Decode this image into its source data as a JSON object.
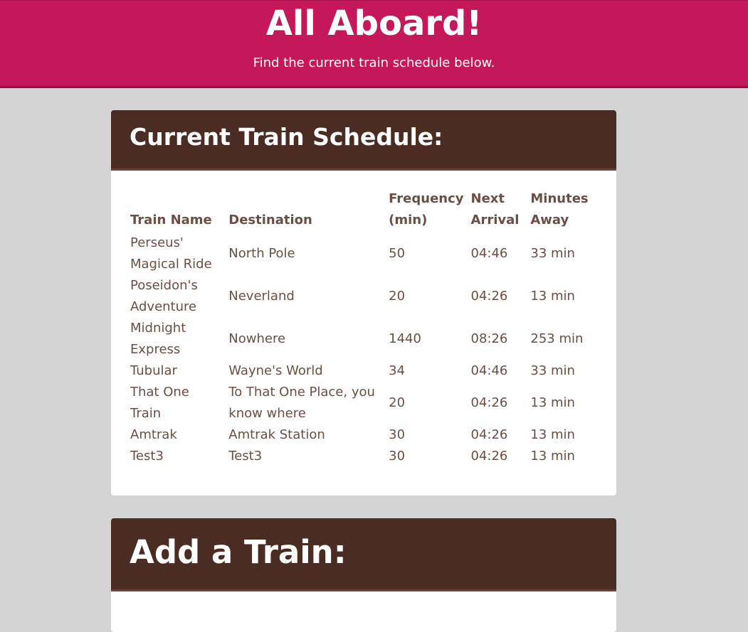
{
  "hero": {
    "title": "All Aboard!",
    "subtitle": "Find the current train schedule below."
  },
  "schedule": {
    "title": "Current Train Schedule:",
    "columns": [
      "Train Name",
      "Destination",
      "Frequency (min)",
      "Next Arrival",
      "Minutes Away"
    ],
    "rows": [
      {
        "name": "Perseus' Magical Ride",
        "destination": "North Pole",
        "frequency": "50",
        "next": "04:46",
        "away": "33 min"
      },
      {
        "name": "Poseidon's Adventure",
        "destination": "Neverland",
        "frequency": "20",
        "next": "04:26",
        "away": "13 min"
      },
      {
        "name": "Midnight Express",
        "destination": "Nowhere",
        "frequency": "1440",
        "next": "08:26",
        "away": "253 min"
      },
      {
        "name": "Tubular",
        "destination": "Wayne's World",
        "frequency": "34",
        "next": "04:46",
        "away": "33 min"
      },
      {
        "name": "That One Train",
        "destination": "To That One Place, you know where",
        "frequency": "20",
        "next": "04:26",
        "away": "13 min"
      },
      {
        "name": "Amtrak",
        "destination": "Amtrak Station",
        "frequency": "30",
        "next": "04:26",
        "away": "13 min"
      },
      {
        "name": "Test3",
        "destination": "Test3",
        "frequency": "30",
        "next": "04:26",
        "away": "13 min"
      }
    ]
  },
  "add_train": {
    "title": "Add a Train:"
  },
  "colors": {
    "hero_bg": "#c4185a",
    "card_header_bg": "#4a2c22",
    "table_text": "#6a4f44",
    "page_bg": "#d4d4d4"
  }
}
